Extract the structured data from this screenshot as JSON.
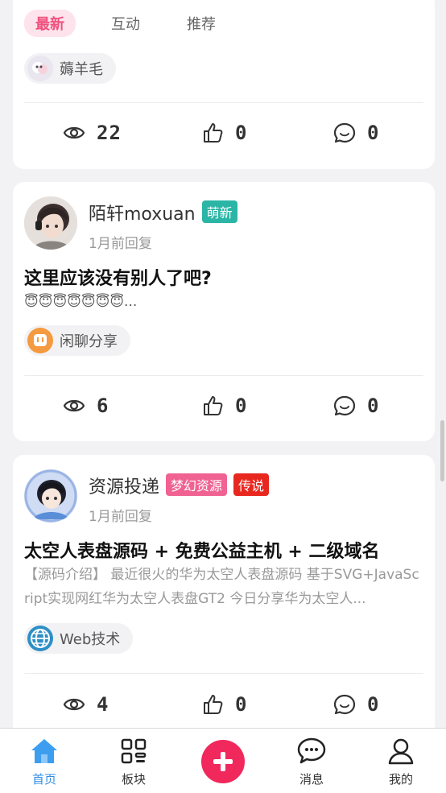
{
  "feed": {
    "tabs": [
      {
        "label": "最新",
        "active": true
      },
      {
        "label": "互动",
        "active": false
      },
      {
        "label": "推荐",
        "active": false
      }
    ],
    "posts": [
      {
        "topic": "薅羊毛",
        "stats": {
          "views": "22",
          "likes": "0",
          "comments": "0"
        }
      },
      {
        "author": "陌轩moxuan",
        "badges": [
          "萌新"
        ],
        "time": "1月前回复",
        "title": "这里应该没有别人了吧?",
        "excerpt": "😇😇😇😇😇😇😇...",
        "topic": "闲聊分享",
        "stats": {
          "views": "6",
          "likes": "0",
          "comments": "0"
        }
      },
      {
        "author": "资源投递",
        "badges": [
          "梦幻资源",
          "传说"
        ],
        "time": "1月前回复",
        "title": "太空人表盘源码 + 免费公益主机 + 二级域名",
        "excerpt": "【源码介绍】 最近很火的华为太空人表盘源码 基于SVG+JavaScript实现网红华为太空人表盘GT2 今日分享华为太空人...",
        "topic": "Web技术",
        "stats": {
          "views": "4",
          "likes": "0",
          "comments": "0"
        }
      }
    ]
  },
  "tabbar": {
    "items": [
      {
        "label": "首页",
        "icon": "home-icon",
        "active": true
      },
      {
        "label": "板块",
        "icon": "grid-icon",
        "active": false
      },
      {
        "label": "",
        "icon": "plus-icon",
        "active": false
      },
      {
        "label": "消息",
        "icon": "message-icon",
        "active": false
      },
      {
        "label": "我的",
        "icon": "user-icon",
        "active": false
      }
    ]
  },
  "colors": {
    "accent_pink": "#f0507e",
    "fab": "#f0285c",
    "tab_active": "#2f8fe6",
    "badge_teal": "#2bb5a6",
    "badge_pink": "#f06292",
    "badge_red": "#e8271f"
  }
}
